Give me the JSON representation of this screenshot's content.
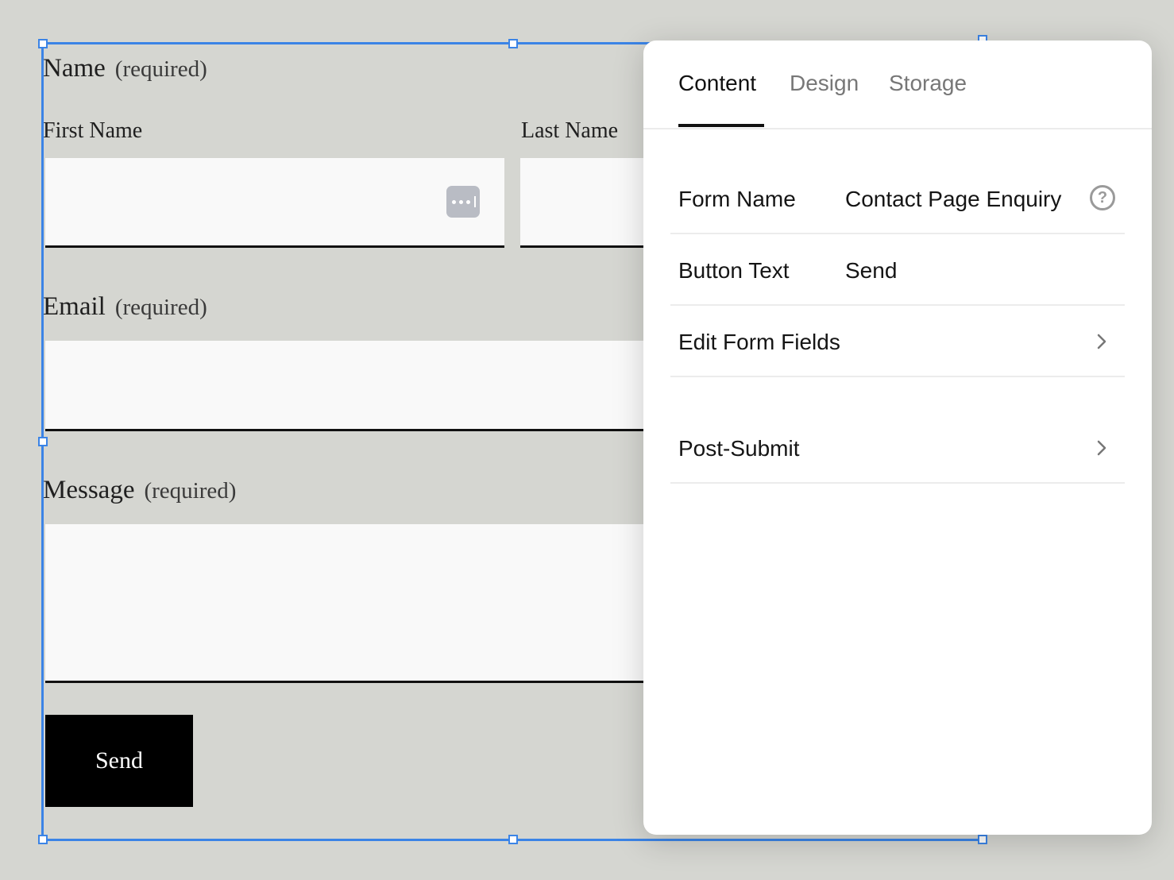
{
  "form": {
    "name_label": "Name",
    "name_required": "(required)",
    "first_name_label": "First Name",
    "last_name_label": "Last Name",
    "email_label": "Email",
    "email_required": "(required)",
    "message_label": "Message",
    "message_required": "(required)",
    "send_label": "Send"
  },
  "panel": {
    "tabs": [
      {
        "label": "Content",
        "active": true
      },
      {
        "label": "Design",
        "active": false
      },
      {
        "label": "Storage",
        "active": false
      }
    ],
    "form_name_label": "Form Name",
    "form_name_value": "Contact Page Enquiry",
    "help_glyph": "?",
    "button_text_label": "Button Text",
    "button_text_value": "Send",
    "edit_fields_label": "Edit Form Fields",
    "post_submit_label": "Post-Submit"
  },
  "colors": {
    "background": "#d5d6d1",
    "selection": "#3b84e6",
    "button": "#000000"
  },
  "icons": {
    "autofill": "autofill-menu-icon",
    "help": "question-circle-icon",
    "chevron": "chevron-right-icon"
  }
}
